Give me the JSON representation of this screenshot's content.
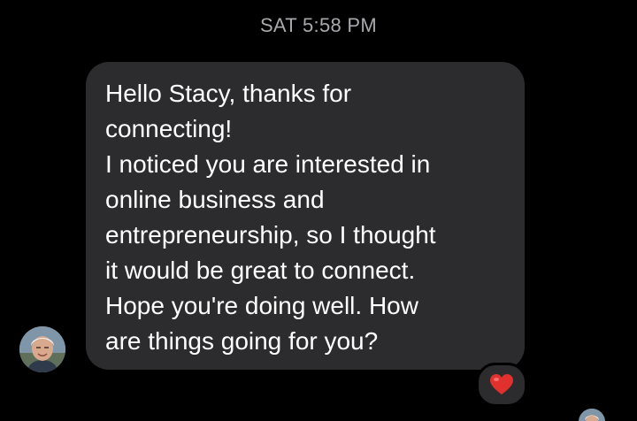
{
  "conversation": {
    "timestamp": "SAT 5:58 PM"
  },
  "message": {
    "lines": [
      "Hello Stacy, thanks for",
      "connecting!",
      "I noticed you are interested in",
      "online business and",
      "entrepreneurship, so I thought",
      "it would be great to connect.",
      "Hope you're doing well. How",
      "are things going for you?"
    ],
    "reaction": "heart-reaction-icon"
  },
  "sender": {
    "avatar": "sender-avatar-photo"
  },
  "colors": {
    "background": "#000000",
    "bubble": "#2c2c2e",
    "timestamp": "#a8a8ad",
    "text": "#ffffff",
    "heart": "#e0312f"
  }
}
